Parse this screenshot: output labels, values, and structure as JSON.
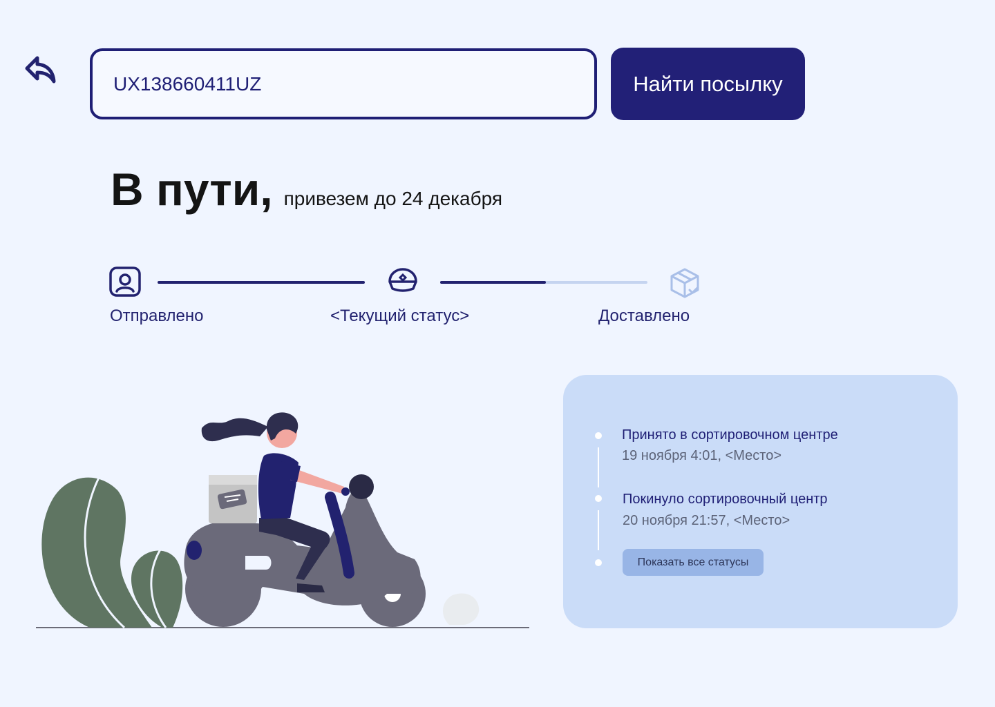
{
  "search": {
    "value": "UX138660411UZ",
    "button_label": "Найти посылку"
  },
  "status": {
    "title": "В пути,",
    "subtitle": "привезем до 24 декабря"
  },
  "progress": {
    "steps": [
      {
        "label": "Отправлено",
        "icon": "user-badge-icon",
        "state": "done"
      },
      {
        "label": "<Текущий статус>",
        "icon": "courier-cap-icon",
        "state": "current"
      },
      {
        "label": "Доставлено",
        "icon": "box-check-icon",
        "state": "pending"
      }
    ],
    "segment_fill": [
      1.0,
      0.51
    ]
  },
  "history": {
    "events": [
      {
        "title": "Принято в сортировочном центре",
        "meta": "19 ноября 4:01, <Место>"
      },
      {
        "title": "Покинуло сортировочный центр",
        "meta": "20 ноября 21:57, <Место>"
      }
    ],
    "show_all_label": "Показать все статусы"
  },
  "colors": {
    "background": "#F0F5FF",
    "primary": "#222077",
    "card": "#CADCF8",
    "inactive": "#C5D4F0"
  }
}
